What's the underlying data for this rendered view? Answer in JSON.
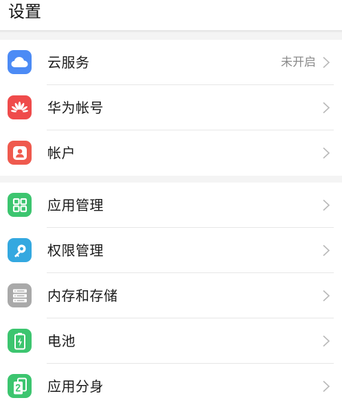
{
  "header": {
    "title": "设置"
  },
  "groups": [
    {
      "items": [
        {
          "label": "云服务",
          "status": "未开启",
          "icon": "cloud-icon",
          "color": "#4c8bf5"
        },
        {
          "label": "华为帐号",
          "icon": "huawei-icon",
          "color": "#ef4b4b"
        },
        {
          "label": "帐户",
          "icon": "user-icon",
          "color": "#ef5a4e"
        }
      ]
    },
    {
      "items": [
        {
          "label": "应用管理",
          "icon": "apps-grid-icon",
          "color": "#3cc56f"
        },
        {
          "label": "权限管理",
          "icon": "key-icon",
          "color": "#34a8e0"
        },
        {
          "label": "内存和存储",
          "icon": "storage-icon",
          "color": "#a9a9a9"
        },
        {
          "label": "电池",
          "icon": "battery-icon",
          "color": "#3cc56f"
        },
        {
          "label": "应用分身",
          "icon": "app-twin-icon",
          "color": "#3cc56f"
        }
      ]
    }
  ]
}
